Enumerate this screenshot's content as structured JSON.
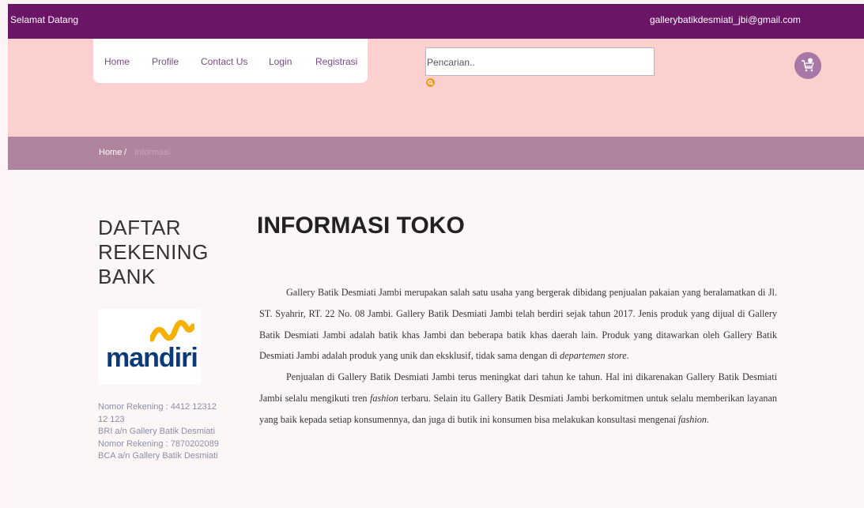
{
  "topbar": {
    "welcome": "Selamat Datang",
    "email": "gallerybatikdesmiati_jbi@gmail.com"
  },
  "nav": {
    "items": [
      "Home",
      "Profile",
      "Contact Us",
      "Login",
      "Registrasi"
    ]
  },
  "search": {
    "placeholder": "Pencarian.."
  },
  "breadcrumb": {
    "home": "Home",
    "separator": "/",
    "current": "Informasi"
  },
  "sidebar": {
    "title": "DAFTAR REKENING BANK",
    "bank_name": "mandiri",
    "accounts": [
      "Nomor Rekening : 4412 12312 12 123\nBRI a/n Gallery Batik Desmiati",
      "Nomor Rekening : 7870202089\nBCA a/n Gallery Batik Desmiati"
    ]
  },
  "main": {
    "title": "INFORMASI TOKO",
    "paragraph1_part1": "Gallery Batik Desmiati Jambi merupakan salah satu usaha yang bergerak dibidang penjualan pakaian yang beralamatkan di Jl. ST. Syahrir, RT. 22 No. 08 Jambi. Gallery Batik Desmiati Jambi telah berdiri sejak tahun 2017. Jenis produk yang dijual di Gallery Batik Desmiati Jambi adalah batik khas Jambi dan beberapa batik khas daerah lain. Produk yang ditawarkan oleh Gallery Batik Desmiati Jambi adalah produk yang unik dan eksklusif, tidak sama dengan di ",
    "paragraph1_em": "departemen store",
    "paragraph1_end": ".",
    "paragraph2_part1": "Penjualan di Gallery Batik Desmiati Jambi terus meningkat dari tahun ke tahun. Hal ini dikarenakan Gallery Batik Desmiati Jambi selalu mengikuti tren ",
    "paragraph2_em1": "fashion",
    "paragraph2_part2": " terbaru. Selain itu Gallery Batik Desmiati Jambi berkomitmen untuk selalu memberikan layanan yang baik kepada setiap konsumennya, dan juga di butik ini konsumen bisa melakukan konsultasi mengenai ",
    "paragraph2_em2": "fashion",
    "paragraph2_end": "."
  },
  "colors": {
    "topbar": "#6b1566",
    "header": "#fdd0d0",
    "breadcrumb_bar": "#b0849f",
    "cart_button": "#a777a5",
    "search_button": "#f19a1e"
  },
  "icons": {
    "search": "search-icon",
    "cart": "cart-icon",
    "bank_logo": "mandiri-logo"
  }
}
